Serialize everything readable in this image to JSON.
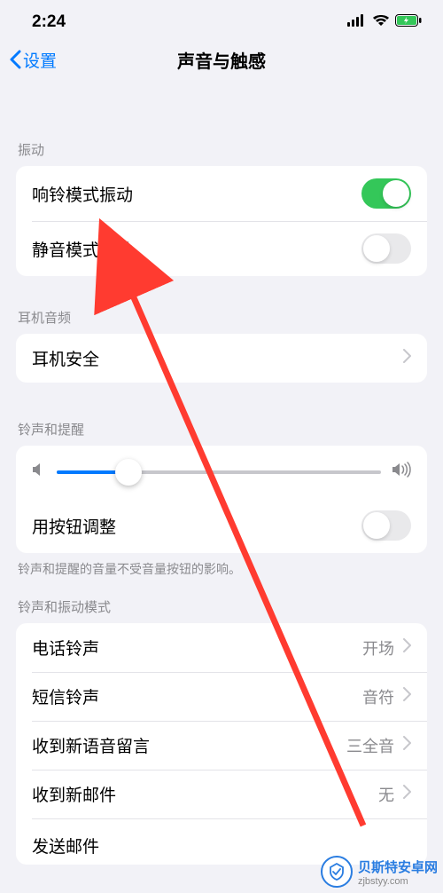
{
  "status": {
    "time": "2:24"
  },
  "nav": {
    "back": "设置",
    "title": "声音与触感"
  },
  "sections": {
    "vibration": {
      "header": "振动",
      "ring_vibrate": {
        "label": "响铃模式振动",
        "on": true
      },
      "silent_vibrate": {
        "label": "静音模式振动",
        "on": false
      }
    },
    "headphone": {
      "header": "耳机音频",
      "safety": {
        "label": "耳机安全"
      }
    },
    "ringer": {
      "header": "铃声和提醒",
      "volume_percent": 22,
      "change_with_buttons": {
        "label": "用按钮调整",
        "on": false
      },
      "footer": "铃声和提醒的音量不受音量按钮的影响。"
    },
    "patterns": {
      "header": "铃声和振动模式",
      "items": [
        {
          "label": "电话铃声",
          "value": "开场"
        },
        {
          "label": "短信铃声",
          "value": "音符"
        },
        {
          "label": "收到新语音留言",
          "value": "三全音"
        },
        {
          "label": "收到新邮件",
          "value": "无"
        },
        {
          "label": "发送邮件",
          "value": ""
        }
      ]
    }
  },
  "watermark": {
    "name": "贝斯特安卓网",
    "url": "zjbstyy.com"
  }
}
